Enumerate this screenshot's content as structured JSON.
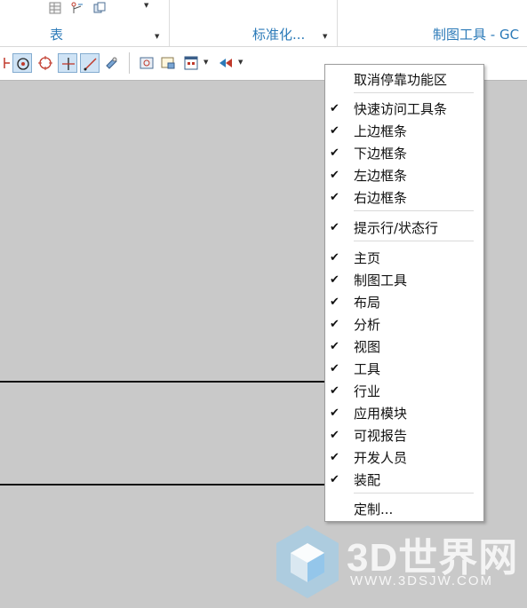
{
  "ribbon": {
    "groups": [
      {
        "label": "表",
        "has_dropdown": true
      },
      {
        "label": "标准化...",
        "has_dropdown": true
      },
      {
        "label": "制图工具 - GC",
        "has_dropdown": false
      }
    ]
  },
  "toolbar": {
    "icons": [
      "point-icon",
      "circle-center-icon",
      "circle-point-icon",
      "crosshair-icon",
      "line-icon",
      "pen-icon",
      "view-frame-icon",
      "sheet-icon",
      "grid-view-icon",
      "arrow-style-icon"
    ]
  },
  "context_menu": {
    "items": [
      {
        "label": "取消停靠功能区",
        "checked": false
      },
      {
        "label": "快速访问工具条",
        "checked": true
      },
      {
        "label": "上边框条",
        "checked": true
      },
      {
        "label": "下边框条",
        "checked": true
      },
      {
        "label": "左边框条",
        "checked": true
      },
      {
        "label": "右边框条",
        "checked": true
      },
      {
        "label": "提示行/状态行",
        "checked": true
      },
      {
        "label": "主页",
        "checked": true
      },
      {
        "label": "制图工具",
        "checked": true
      },
      {
        "label": "布局",
        "checked": true
      },
      {
        "label": "分析",
        "checked": true
      },
      {
        "label": "视图",
        "checked": true
      },
      {
        "label": "工具",
        "checked": true
      },
      {
        "label": "行业",
        "checked": true
      },
      {
        "label": "应用模块",
        "checked": true
      },
      {
        "label": "可视报告",
        "checked": true
      },
      {
        "label": "开发人员",
        "checked": true
      },
      {
        "label": "装配",
        "checked": true
      },
      {
        "label": "定制...",
        "checked": false
      }
    ],
    "check_mark": "✔"
  },
  "watermark": {
    "title": "3D世界网",
    "subtitle": "WWW.3DSJW.COM"
  },
  "colors": {
    "canvas": "#c9c9c9",
    "ribbon_label": "#2b7ab8",
    "pressed_button": "#cfe3f5"
  }
}
